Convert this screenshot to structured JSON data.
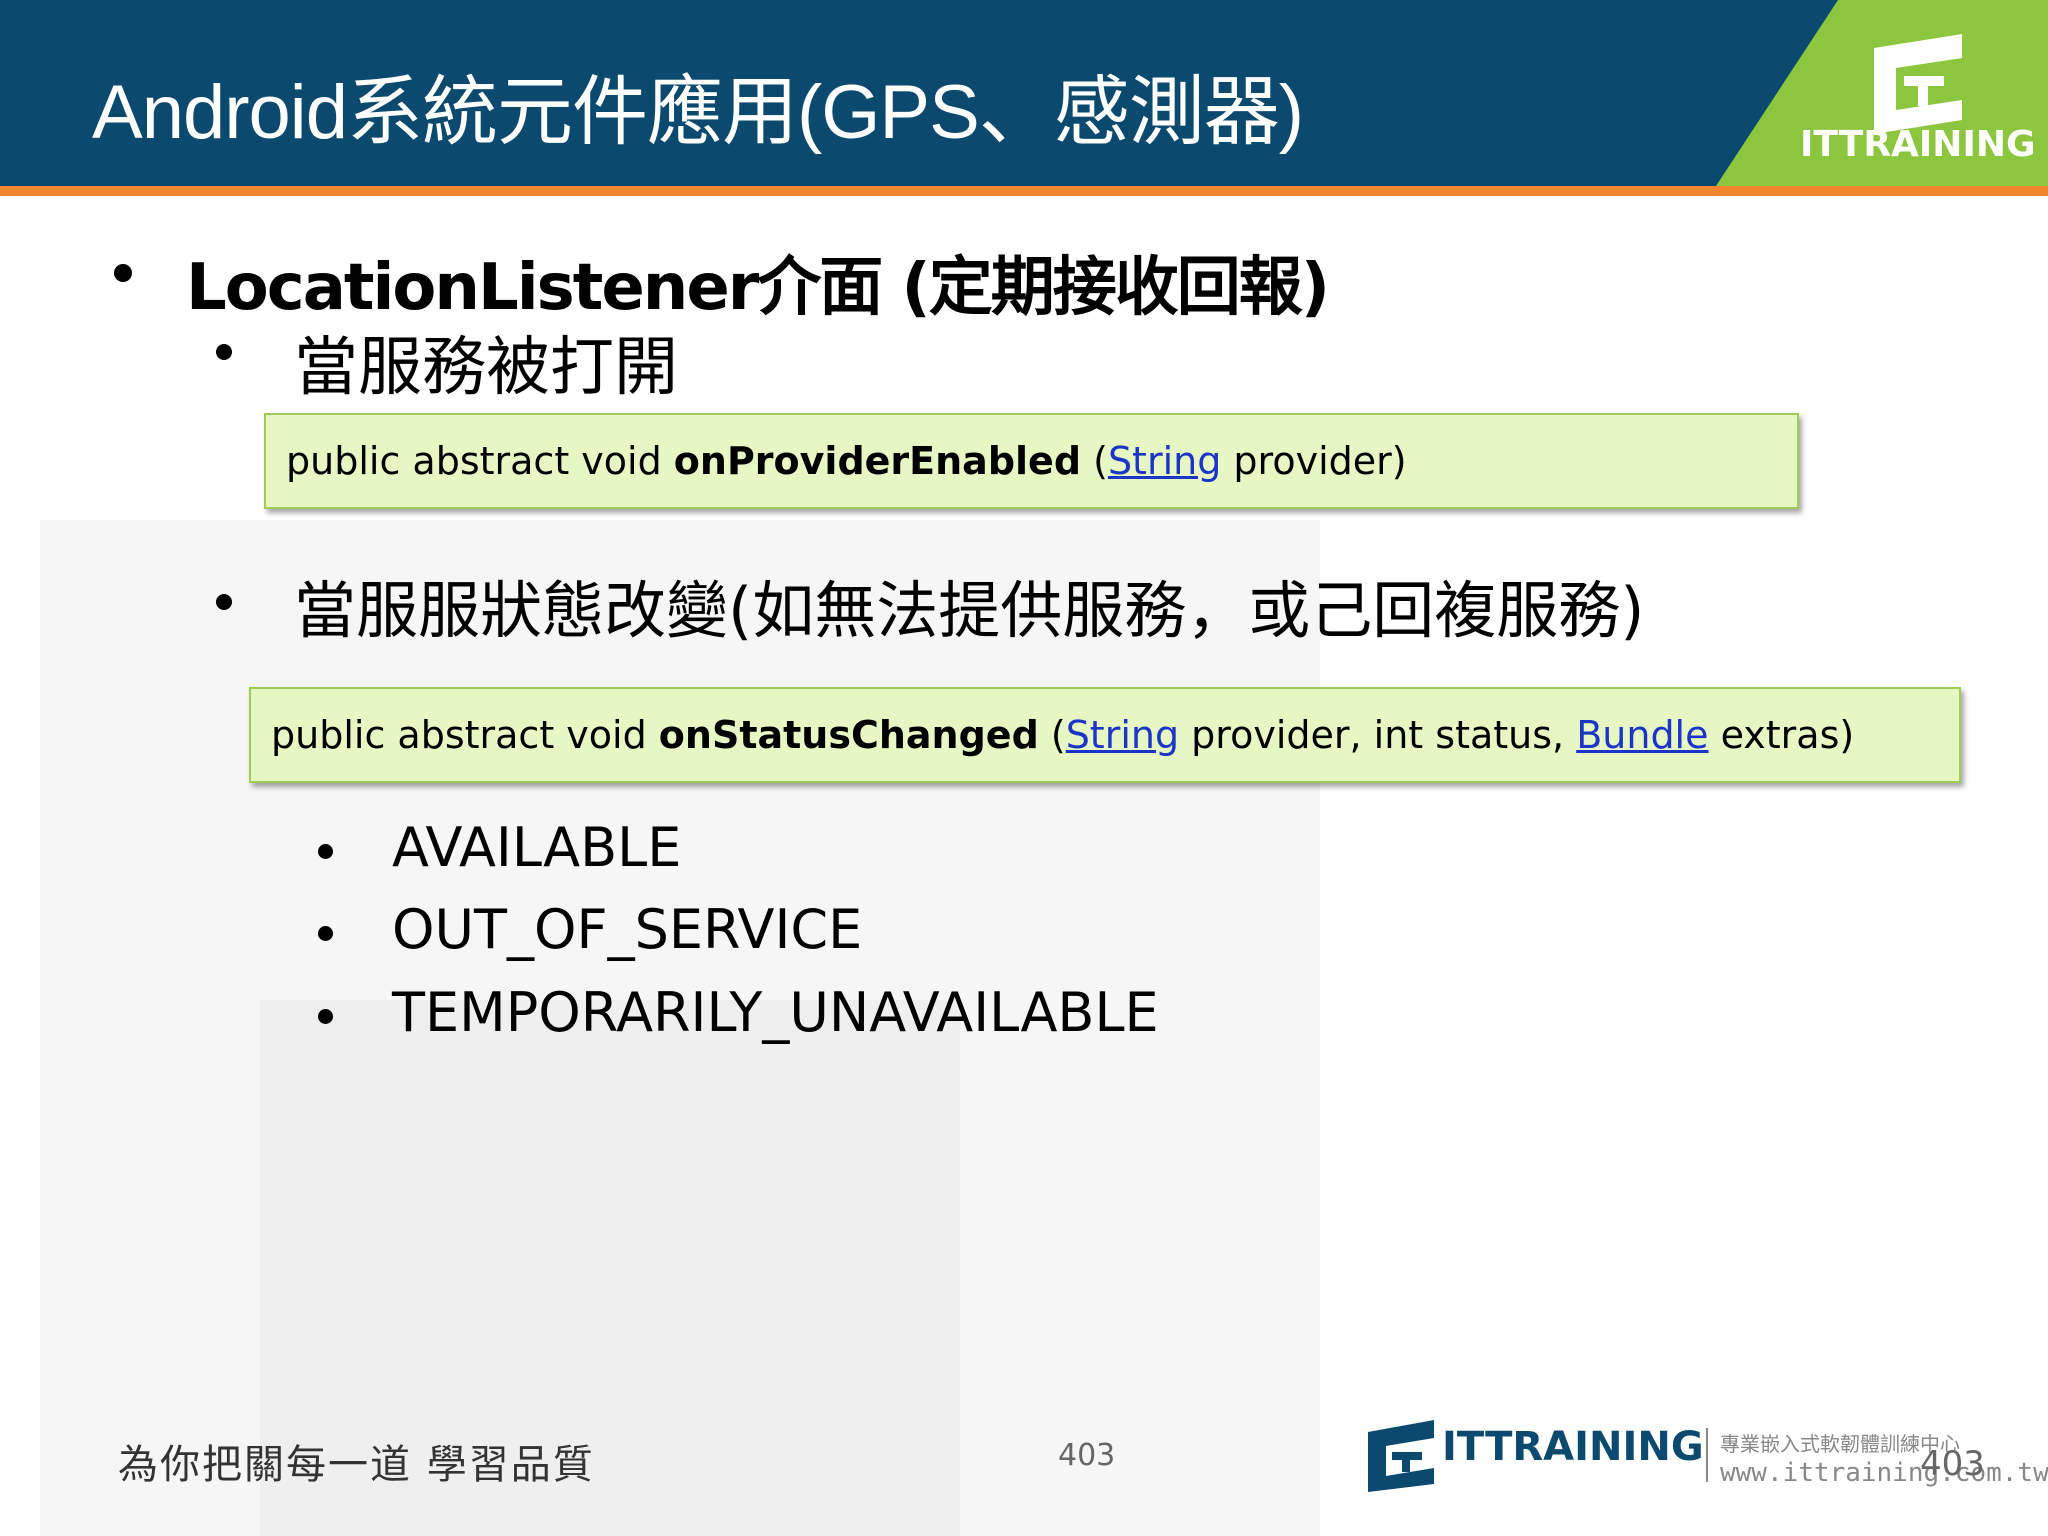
{
  "header": {
    "title": "Android系統元件應用(GPS、感測器)",
    "logo_text": "ITTRAINING"
  },
  "content": {
    "bullet_main": "LocationListener介面 (定期接收回報)",
    "bullet_enabled": "當服務被打開",
    "code_enabled": {
      "prefix": "public abstract void ",
      "method": "onProviderEnabled",
      "open": " (",
      "type_link": "String",
      "rest": " provider)"
    },
    "bullet_status": "當服服狀態改變(如無法提供服務，或己回複服務)",
    "code_status": {
      "prefix": "public abstract void ",
      "method": "onStatusChanged",
      "open": " (",
      "type_link": "String",
      "middle": " provider, int status, ",
      "type_link2": "Bundle",
      "rest": " extras)"
    },
    "status_values": [
      "AVAILABLE",
      "OUT_OF_SERVICE",
      "TEMPORARILY_UNAVAILABLE"
    ]
  },
  "footer": {
    "slogan": "為你把關每一道 學習品質",
    "page_number": "403",
    "page_number_right": "403",
    "logo_text": "ITTRAINING",
    "tagline": "專業嵌入式軟韌體訓練中心",
    "website": "www.ittraining.com.tw"
  },
  "colors": {
    "header_bg": "#0b4a6e",
    "header_stripe": "#f0852d",
    "logo_green": "#8cc63f",
    "code_bg": "#e7f7c3",
    "link": "#1a35c7"
  }
}
